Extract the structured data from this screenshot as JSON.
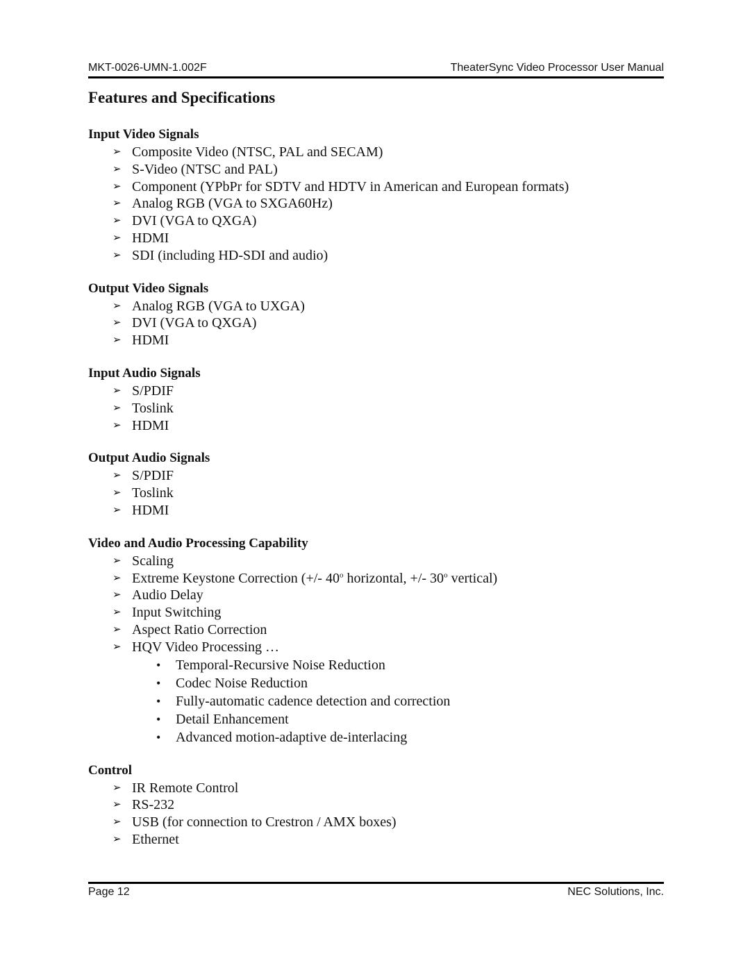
{
  "header": {
    "doc_id": "MKT-0026-UMN-1.002F",
    "manual_title": "TheaterSync Video Processor User Manual"
  },
  "title": "Features and Specifications",
  "sections": [
    {
      "heading": "Input Video Signals",
      "items": [
        "Composite Video (NTSC, PAL and SECAM)",
        "S-Video (NTSC and PAL)",
        "Component (YPbPr for SDTV and HDTV in American and European formats)",
        "Analog RGB (VGA to SXGA60Hz)",
        "DVI (VGA to QXGA)",
        "HDMI",
        "SDI (including HD-SDI and audio)"
      ]
    },
    {
      "heading": "Output Video Signals",
      "items": [
        "Analog RGB (VGA to UXGA)",
        "DVI (VGA to QXGA)",
        "HDMI"
      ]
    },
    {
      "heading": "Input Audio Signals",
      "items": [
        "S/PDIF",
        "Toslink",
        "HDMI"
      ]
    },
    {
      "heading": "Output Audio Signals",
      "items": [
        "S/PDIF",
        "Toslink",
        "HDMI"
      ]
    },
    {
      "heading": "Video and Audio Processing Capability",
      "items": [
        "Scaling",
        {
          "parts": [
            "Extreme Keystone Correction (+/- 40",
            "o",
            " horizontal, +/- 30",
            "o",
            " vertical)"
          ]
        },
        "Audio Delay",
        "Input Switching",
        "Aspect Ratio Correction",
        "HQV Video Processing …"
      ],
      "sub_items": [
        "Temporal-Recursive Noise Reduction",
        "Codec Noise Reduction",
        "Fully-automatic cadence detection and correction",
        "Detail Enhancement",
        "Advanced motion-adaptive de-interlacing"
      ]
    },
    {
      "heading": "Control",
      "items": [
        "IR Remote Control",
        "RS-232",
        "USB (for connection to Crestron / AMX boxes)",
        "Ethernet"
      ]
    }
  ],
  "icons": {
    "arrow_bullet": "➢",
    "round_bullet": "•"
  },
  "footer": {
    "page": "Page 12",
    "company": "NEC Solutions, Inc."
  }
}
